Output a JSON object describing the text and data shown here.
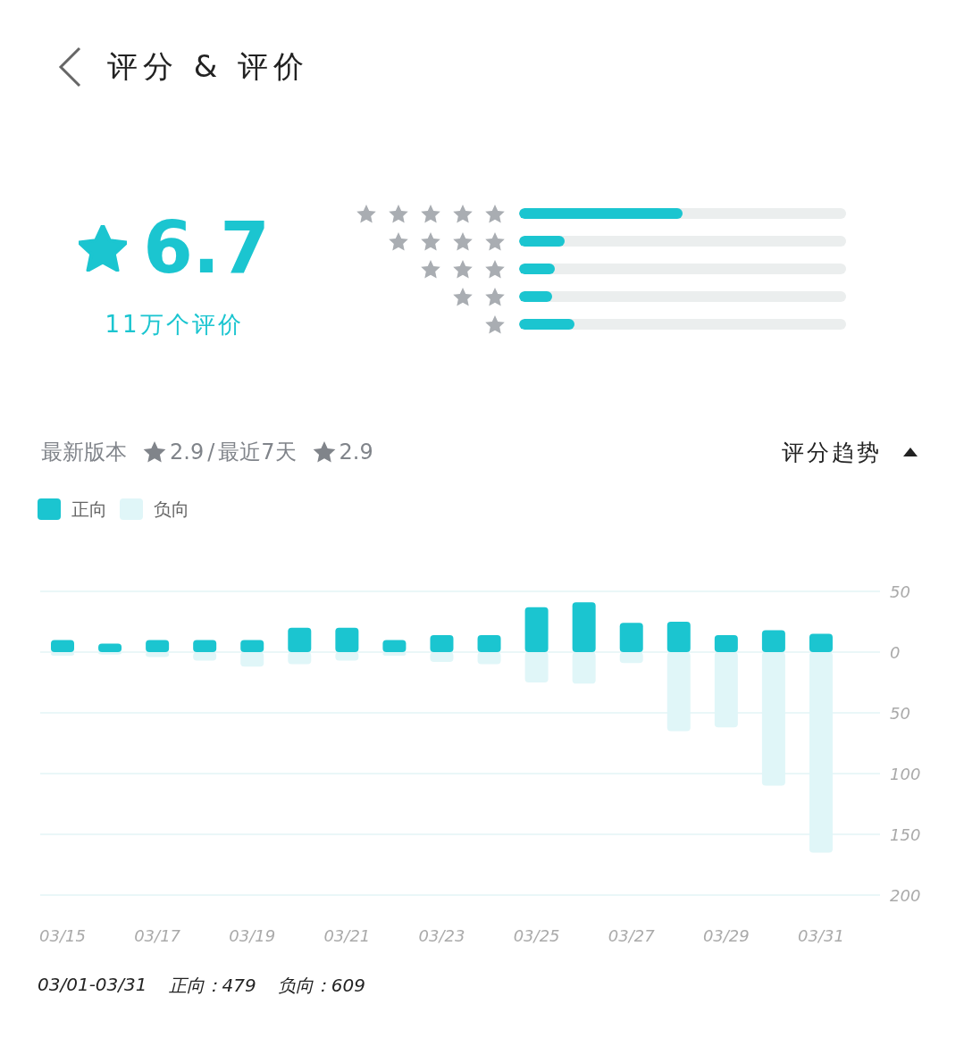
{
  "header": {
    "title": "评分 & 评价"
  },
  "score": {
    "value": "6.7",
    "count": "11万个评价"
  },
  "ratings": [
    {
      "level": 0.5
    },
    {
      "level": 0.14
    },
    {
      "level": 0.11
    },
    {
      "level": 0.1
    },
    {
      "level": 0.17
    }
  ],
  "summary": {
    "latest_label": "最新版本",
    "latest_score": "2.9",
    "separator": "/",
    "recent_label": "最近7天",
    "recent_score": "2.9"
  },
  "trend_toggle": {
    "label": "评分趋势",
    "expanded": true
  },
  "chart_data": {
    "type": "bar",
    "stacked": true,
    "grid": true,
    "categories": [
      "03/15",
      null,
      "03/17",
      null,
      "03/19",
      null,
      "03/21",
      null,
      "03/23",
      null,
      "03/25",
      null,
      "03/27",
      null,
      "03/29",
      null,
      "03/31"
    ],
    "series": [
      {
        "name": "正向",
        "color": "#1bc5d0",
        "values": [
          10,
          7,
          10,
          10,
          10,
          20,
          20,
          10,
          14,
          14,
          37,
          41,
          24,
          25,
          14,
          18,
          15
        ]
      },
      {
        "name": "负向",
        "color": "#e0f6f8",
        "values": [
          -3,
          -2,
          -4,
          -7,
          -12,
          -10,
          -7,
          -3,
          -8,
          -10,
          -25,
          -26,
          -9,
          -65,
          -62,
          -110,
          -165
        ]
      }
    ],
    "ylim": [
      -200,
      50
    ],
    "yticks": [
      {
        "value": 50,
        "label": "50"
      },
      {
        "value": 0,
        "label": "0"
      },
      {
        "value": -50,
        "label": "50"
      },
      {
        "value": -100,
        "label": "100"
      },
      {
        "value": -150,
        "label": "150"
      },
      {
        "value": -200,
        "label": "200"
      }
    ]
  },
  "footer": {
    "range": "03/01-03/31",
    "positive": "正向：479",
    "negative": "负向：609"
  }
}
